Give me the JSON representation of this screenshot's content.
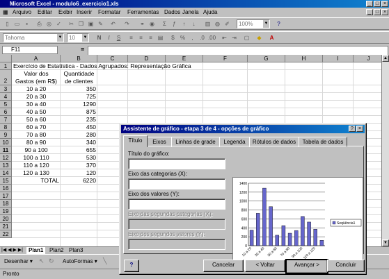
{
  "window": {
    "title": "Microsoft Excel - modulo6_exercicio1.xls",
    "controls": [
      "_",
      "□",
      "×"
    ]
  },
  "menubar": [
    "Arquivo",
    "Editar",
    "Exibir",
    "Inserir",
    "Formatar",
    "Ferramentas",
    "Dados",
    "Janela",
    "Ajuda"
  ],
  "toolbar": {
    "zoom": "100%",
    "font": "Tahoma",
    "font_size": "10"
  },
  "formula_bar": {
    "name_box": "F11",
    "equals": "="
  },
  "columns": [
    "A",
    "B",
    "C",
    "D",
    "E",
    "F",
    "G",
    "H",
    "I",
    "J",
    "K"
  ],
  "rows": [
    "1",
    "2",
    "3",
    "4",
    "5",
    "6",
    "7",
    "8",
    "9",
    "10",
    "11",
    "12",
    "13",
    "14",
    "15",
    "16",
    "17",
    "18",
    "19",
    "20",
    "21",
    "22"
  ],
  "sheet": {
    "title": "Exercício de Estatística - Dados Agrupados: Representação Gráfica",
    "header_a1": "Valor dos",
    "header_a2": "Gastos (em R$)",
    "header_b1": "Quantidade",
    "header_b2": "de clientes",
    "data": [
      {
        "range": "10 a 20",
        "count": "350"
      },
      {
        "range": "20 a 30",
        "count": "725"
      },
      {
        "range": "30 a 40",
        "count": "1290"
      },
      {
        "range": "40 a 50",
        "count": "875"
      },
      {
        "range": "50 a 60",
        "count": "235"
      },
      {
        "range": "60 a 70",
        "count": "450"
      },
      {
        "range": "70 a 80",
        "count": "280"
      },
      {
        "range": "80 a 90",
        "count": "340"
      },
      {
        "range": "90 a 100",
        "count": "655"
      },
      {
        "range": "100 a 110",
        "count": "530"
      },
      {
        "range": "110 a 120",
        "count": "370"
      },
      {
        "range": "120 a 130",
        "count": "120"
      }
    ],
    "total_label": "TOTAL",
    "total_value": "6220"
  },
  "sheet_tabs": [
    "Plan1",
    "Plan2",
    "Plan3"
  ],
  "drawbar": {
    "draw": "Desenhar",
    "autoshapes": "AutoFormas"
  },
  "status": "Pronto",
  "dialog": {
    "title": "Assistente de gráfico - etapa 3 de 4 - opções de gráfico",
    "help_glyph": "?",
    "close_glyph": "×",
    "tabs": [
      "Título",
      "Eixos",
      "Linhas de grade",
      "Legenda",
      "Rótulos de dados",
      "Tabela de dados"
    ],
    "fields": {
      "chart_title": "Título do gráfico:",
      "category_axis": "Eixo das categorias (X):",
      "value_axis": "Eixo dos valores (Y):",
      "second_category_axis": "Eixo das segundas categorias (X):",
      "second_value_axis": "Eixo dos segundos valores (Y):"
    },
    "buttons": {
      "cancel": "Cancelar",
      "back": "< Voltar",
      "next": "Avançar >",
      "finish": "Concluir"
    }
  },
  "chart_data": {
    "type": "bar",
    "categories": [
      "10 a 20",
      "20 a 30",
      "30 a 40",
      "40 a 50",
      "50 a 60",
      "60 a 70",
      "70 a 80",
      "80 a 90",
      "90 a 100",
      "100 a 110",
      "110 a 120",
      "120 a 130"
    ],
    "x_tick_labels": [
      "10 a 20",
      "30 a 40",
      "50 a 60",
      "70 a 80",
      "90 a 100",
      "110 a 120"
    ],
    "series": [
      {
        "name": "Seqüência1",
        "values": [
          350,
          725,
          1290,
          875,
          235,
          450,
          280,
          340,
          655,
          530,
          370,
          120
        ]
      }
    ],
    "ylim": [
      0,
      1400
    ],
    "yticks": [
      0,
      200,
      400,
      600,
      800,
      1000,
      1200,
      1400
    ],
    "legend": "right",
    "bar_color": "#6666cc",
    "grid": true
  }
}
